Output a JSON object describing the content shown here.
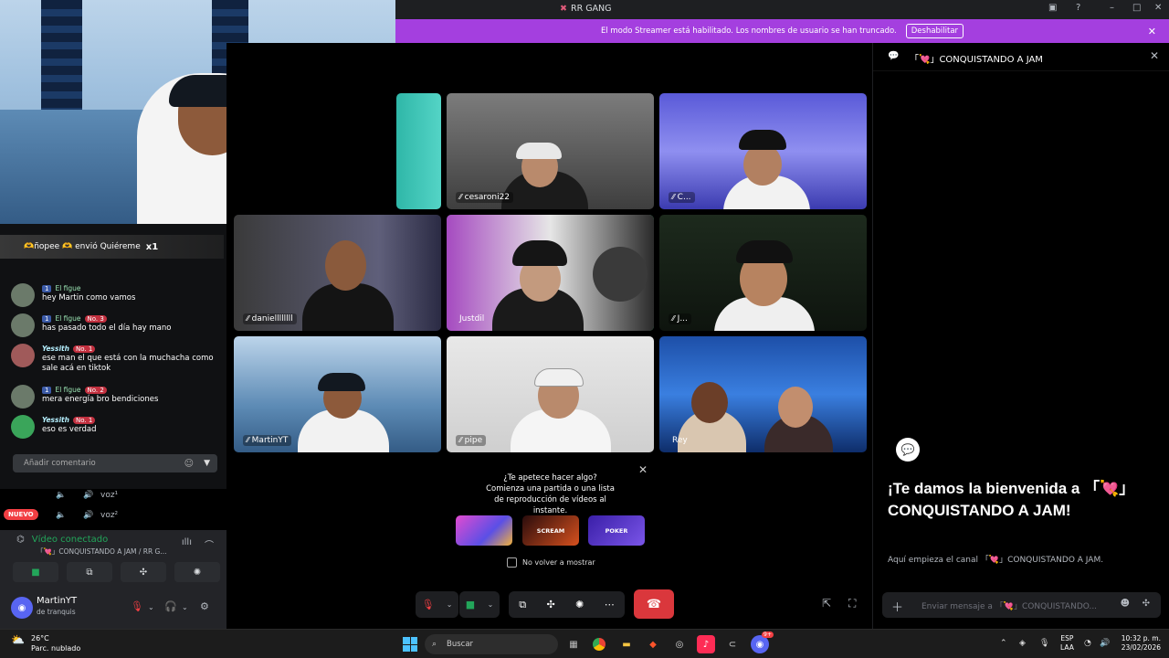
{
  "window": {
    "title": "RR GANG",
    "logo_icon": "rr-gang-server-icon"
  },
  "streamer_banner": {
    "text": "El modo Streamer está habilitado. Los nombres de usuario se han truncado.",
    "button": "Deshabilitar",
    "color": "#a43fdf"
  },
  "live_chat": {
    "donation": {
      "text": "🫶ñopee 🫶 envió Quiéreme",
      "count": "x1"
    },
    "messages": [
      {
        "user": "El figue",
        "badge": "1",
        "rank": "",
        "text": "hey Martin como vamos"
      },
      {
        "user": "El figue",
        "badge": "1",
        "rank": "No. 3",
        "text": "has pasado todo el día hay mano"
      },
      {
        "user": "Yessith",
        "badge": "",
        "rank": "No. 1",
        "text": "ese man el que está con la muchacha como sale acá en tiktok"
      },
      {
        "user": "El figue",
        "badge": "1",
        "rank": "No. 2",
        "text": "mera energía bro bendiciones"
      },
      {
        "user": "Yessith",
        "badge": "",
        "rank": "No. 1",
        "text": "eso es verdad"
      }
    ],
    "comment_placeholder": "Añadir comentario"
  },
  "sidebar": {
    "voice_channels": [
      {
        "label": "voz¹"
      },
      {
        "label": "voz²"
      }
    ],
    "new_badge": "NUEVO",
    "voice_connection": {
      "status": "Vídeo conectado",
      "channel": "「💘」CONQUISTANDO A JAM / RR G..."
    },
    "user": {
      "name": "MartinYT",
      "status": "de tranquis"
    }
  },
  "video_grid": {
    "tiles": [
      {
        "name": ""
      },
      {
        "name": "cesaroni22"
      },
      {
        "name": "C..."
      },
      {
        "name": "daniellllllll"
      },
      {
        "name": "Justdil"
      },
      {
        "name": "J..."
      },
      {
        "name": "MartinYT"
      },
      {
        "name": "pipe"
      },
      {
        "name": "Rey"
      }
    ],
    "speaking_accent": "#23a55a"
  },
  "activity_popup": {
    "question": "¿Te apetece hacer algo?",
    "description": "Comienza una partida o una lista de reproducción de vídeos al instante.",
    "activities": [
      "",
      "SCREAM",
      "POKER"
    ],
    "checkbox_label": "No volver a mostrar"
  },
  "channel_panel": {
    "header": "「💘」CONQUISTANDO A JAM",
    "welcome_title": "¡Te damos la bienvenida a 「💘」CONQUISTANDO A JAM!",
    "welcome_sub": "Aquí empieza el canal 「💘」CONQUISTANDO A JAM.",
    "input_placeholder": "Enviar mensaje a 「💘」CONQUISTANDO..."
  },
  "taskbar": {
    "weather_temp": "26°C",
    "weather_desc": "Parc. nublado",
    "search": "Buscar",
    "lang_top": "ESP",
    "lang_bottom": "LAA",
    "time": "10:32 p. m.",
    "date": "23/02/2026",
    "discord_badge": "9+"
  }
}
